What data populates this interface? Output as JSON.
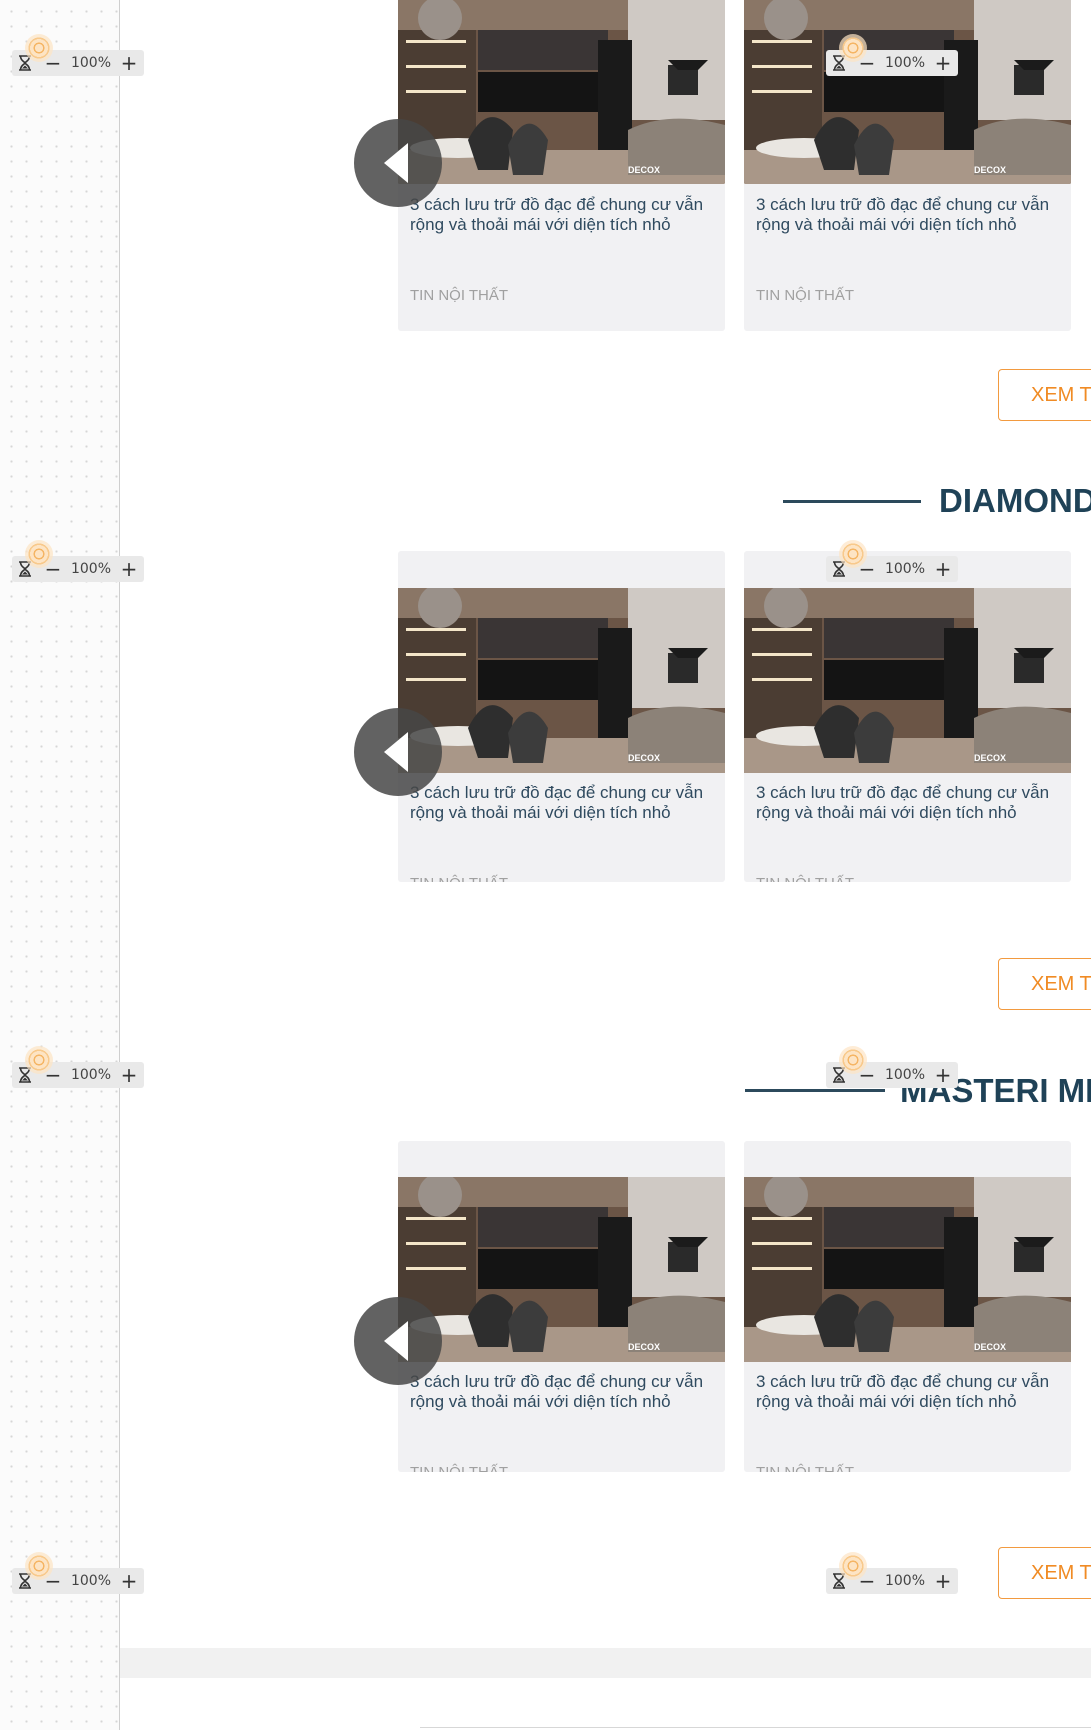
{
  "zoom": {
    "value": "100%",
    "minus": "−",
    "plus": "+"
  },
  "sections": [
    {
      "title": "",
      "more_label": "XEM TH"
    },
    {
      "title": "DIAMOND",
      "more_label": "XEM TH"
    },
    {
      "title": "MASTERI MI",
      "more_label": "XEM TH"
    }
  ],
  "card": {
    "title": "3 cách lưu trữ đồ đạc để chung cư vẫn rộng và thoải mái với diện tích nhỏ",
    "category": "TIN NỘI THẤT",
    "watermark": "DECOX"
  },
  "colors": {
    "accent": "#f08b24",
    "heading": "#1f4257",
    "card_bg": "#f1f1f3"
  }
}
